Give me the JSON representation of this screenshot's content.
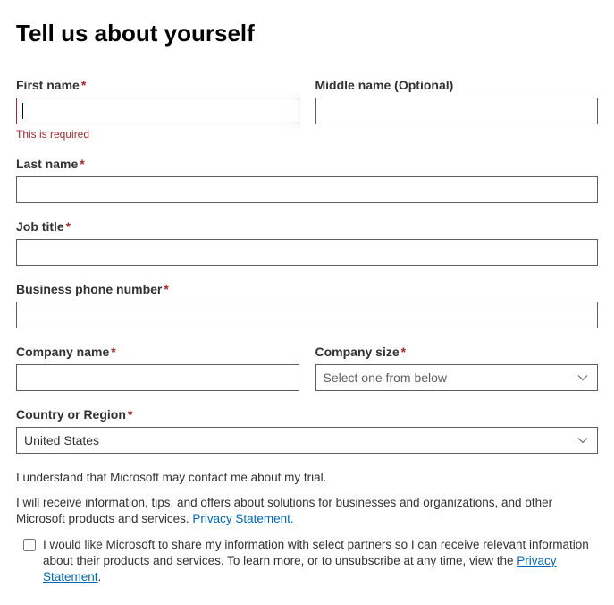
{
  "heading": "Tell us about yourself",
  "fields": {
    "first_name": {
      "label": "First name",
      "required_marker": "*",
      "value": "",
      "error": "This is required"
    },
    "middle_name": {
      "label": "Middle name (Optional)",
      "value": ""
    },
    "last_name": {
      "label": "Last name",
      "required_marker": "*",
      "value": ""
    },
    "job_title": {
      "label": "Job title",
      "required_marker": "*",
      "value": ""
    },
    "business_phone": {
      "label": "Business phone number",
      "required_marker": "*",
      "value": ""
    },
    "company_name": {
      "label": "Company name",
      "required_marker": "*",
      "value": ""
    },
    "company_size": {
      "label": "Company size",
      "required_marker": "*",
      "placeholder": "Select one from below"
    },
    "country": {
      "label": "Country or Region",
      "required_marker": "*",
      "value": "United States"
    }
  },
  "disclosures": {
    "trial_contact": "I understand that Microsoft may contact me about my trial.",
    "tips_info_prefix": "I will receive information, tips, and offers about solutions for businesses and organizations, and other Microsoft products and services. ",
    "privacy_link_text": "Privacy Statement."
  },
  "consent": {
    "text_prefix": "I would like Microsoft to share my information with select partners so I can receive relevant information about their products and services. To learn more, or to unsubscribe at any time, view the ",
    "link_text": "Privacy Statement",
    "text_suffix": "."
  }
}
